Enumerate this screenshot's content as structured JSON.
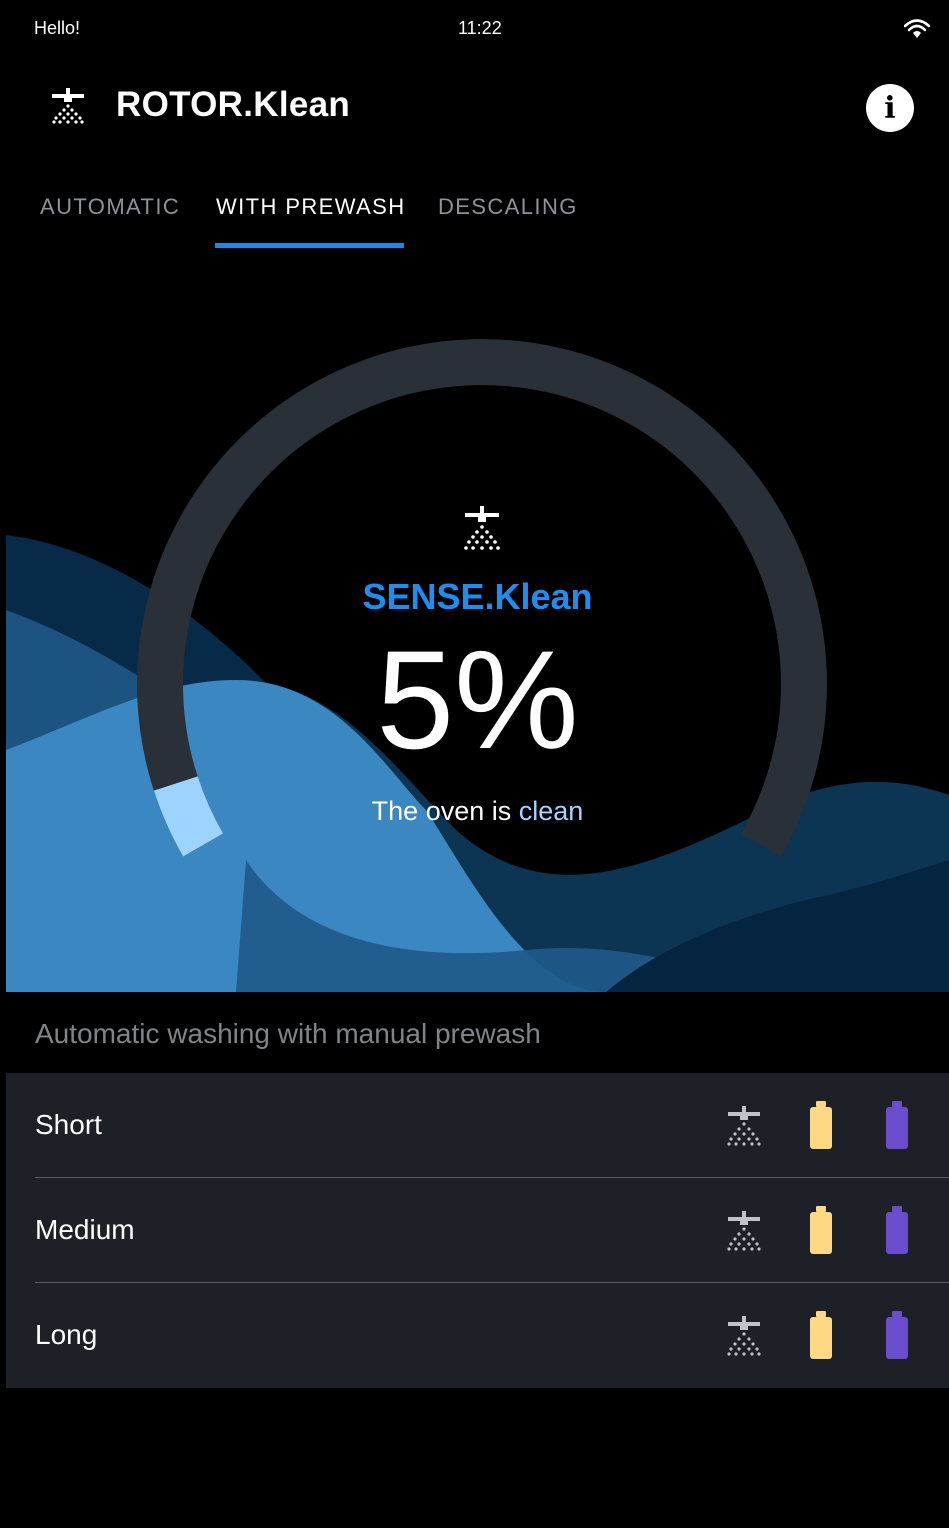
{
  "status_bar": {
    "left_text": "Hello!",
    "time": "11:22",
    "wifi_icon": "wifi-icon"
  },
  "app_bar": {
    "title": "ROTOR.Klean",
    "logo_icon": "shower-icon",
    "info_icon": "info-icon",
    "info_glyph": "i"
  },
  "tabs": [
    {
      "label": "AUTOMATIC",
      "active": false
    },
    {
      "label": "WITH PREWASH",
      "active": true
    },
    {
      "label": "DESCALING",
      "active": false
    }
  ],
  "gauge": {
    "title": "SENSE.Klean",
    "value": "5%",
    "fraction": 0.05,
    "status_prefix": "The oven is",
    "status_word": "clean",
    "track_color": "#2a3037",
    "fill_color": "#9dd3ff"
  },
  "section": {
    "label": "Automatic washing with manual prewash"
  },
  "programs": [
    {
      "name": "Short",
      "icons": [
        "spray-icon",
        "yellow-cartridge-icon",
        "purple-cartridge-icon"
      ]
    },
    {
      "name": "Medium",
      "icons": [
        "spray-icon",
        "yellow-cartridge-icon",
        "purple-cartridge-icon"
      ]
    },
    {
      "name": "Long",
      "icons": [
        "spray-icon",
        "yellow-cartridge-icon",
        "purple-cartridge-icon"
      ]
    }
  ],
  "colors": {
    "accent": "#1c8ef2",
    "cartridge_yellow": "#ffd883",
    "cartridge_purple": "#6a4ccc",
    "panel": "#1d2026"
  }
}
